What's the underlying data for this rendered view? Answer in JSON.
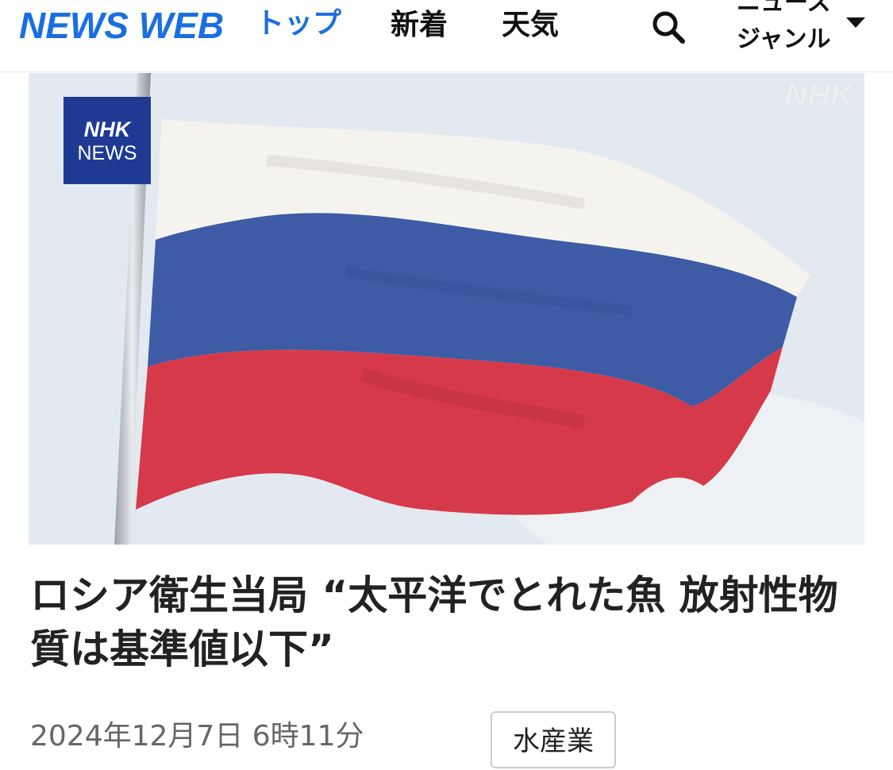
{
  "header": {
    "logo": "NEWS WEB",
    "top_label": "トップ",
    "nav": [
      "新着",
      "天気"
    ],
    "genre_line1": "ニュース",
    "genre_line2": "ジャンル",
    "brand_color": "#1a6fe0"
  },
  "hero": {
    "badge_line1": "NHK",
    "badge_line2": "NEWS",
    "watermark": "NHK",
    "flag_colors": [
      "#f4f3ee",
      "#3e5ba6",
      "#d63a4a"
    ]
  },
  "article": {
    "title": "ロシア衛生当局 “太平洋でとれた魚 放射性物質は基準値以下”",
    "date": "2024年12月7日 6時11分",
    "tag": "水産業"
  },
  "icons": {
    "search": "search-icon",
    "dropdown": "chevron-down-icon"
  }
}
